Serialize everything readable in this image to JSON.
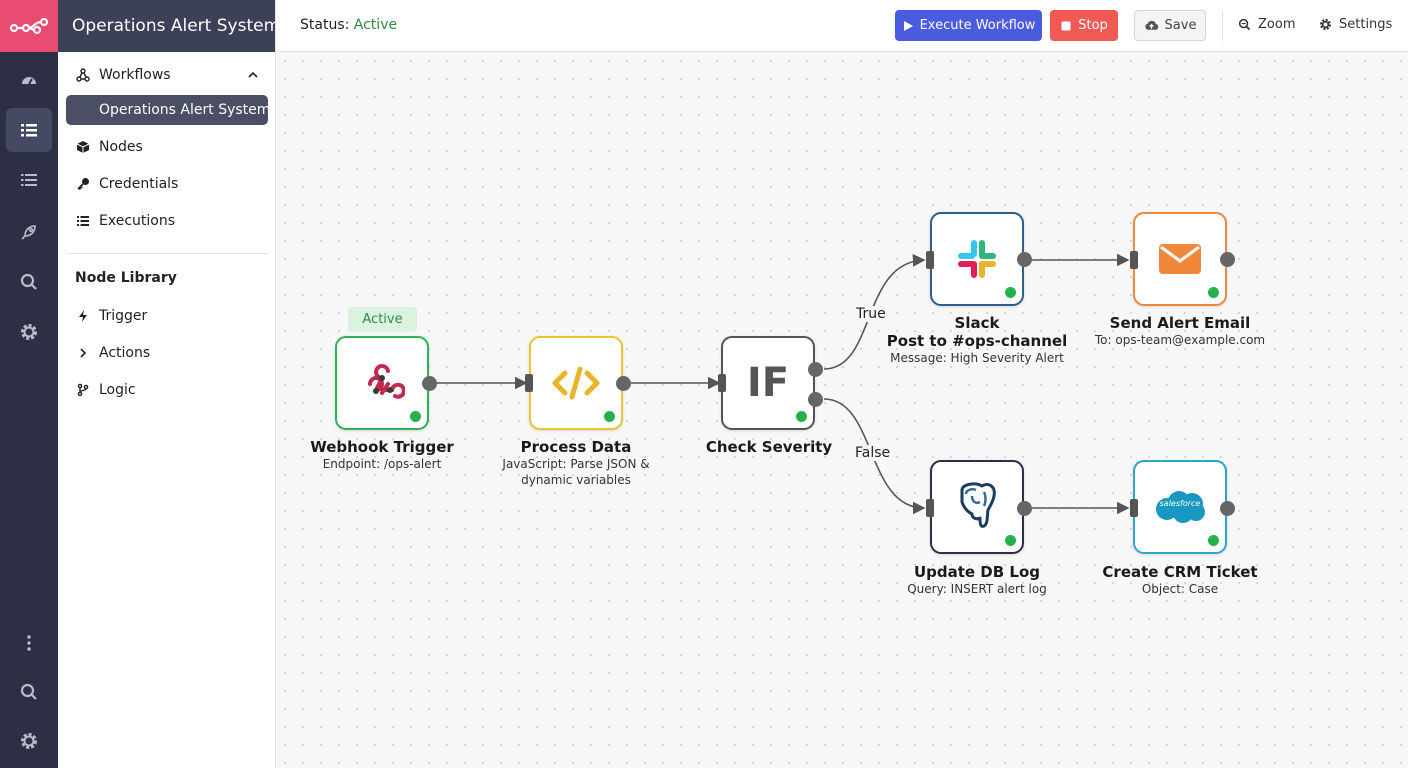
{
  "app": {
    "title": "Operations Alert System"
  },
  "rail": {
    "items": [
      {
        "icon": "n8n-logo-icon"
      },
      {
        "icon": "dashboard-icon"
      },
      {
        "icon": "list-icon"
      },
      {
        "icon": "list-alt-icon"
      },
      {
        "icon": "rocket-icon"
      },
      {
        "icon": "search-icon"
      },
      {
        "icon": "gear-icon"
      },
      {
        "icon": "more-vertical-icon"
      },
      {
        "icon": "search-icon"
      },
      {
        "icon": "gear-icon"
      }
    ]
  },
  "sidebar": {
    "workflows_label": "Workflows",
    "selected_workflow": "Operations Alert System",
    "nodes_label": "Nodes",
    "credentials_label": "Credentials",
    "executions_label": "Executions",
    "library_heading": "Node Library",
    "trigger_label": "Trigger",
    "actions_label": "Actions",
    "logic_label": "Logic"
  },
  "topbar": {
    "status_label": "Status:",
    "status_value": "Active",
    "execute_label": "Execute Workflow",
    "stop_label": "Stop",
    "save_label": "Save",
    "zoom_label": "Zoom",
    "settings_label": "Settings"
  },
  "colors": {
    "brand": "#ea4b71",
    "execute": "#4b5be0",
    "stop": "#ef5a55",
    "active": "#2e8b3e",
    "webhook": "#2fb157",
    "code": "#e6c432",
    "slack_border": "#2d5f8a",
    "email": "#f0883c",
    "salesforce": "#2aa6c9"
  },
  "canvas": {
    "active_badge": "Active",
    "edge_true": "True",
    "edge_false": "False",
    "nodes": [
      {
        "id": "webhook",
        "title": "Webhook Trigger",
        "subtitle": "Endpoint: /ops-alert",
        "subtitle2": ""
      },
      {
        "id": "code",
        "title": "Process Data",
        "subtitle": "JavaScript: Parse JSON &",
        "subtitle2": "dynamic variables"
      },
      {
        "id": "if",
        "title": "Check Severity",
        "subtitle": "",
        "subtitle2": "",
        "glyph": "IF"
      },
      {
        "id": "slack",
        "title": "Slack",
        "title2": "Post to #ops-channel",
        "subtitle": "Message: High Severity Alert"
      },
      {
        "id": "email",
        "title": "Send Alert Email",
        "subtitle": "To: ops-team@example.com"
      },
      {
        "id": "postgres",
        "title": "Update DB Log",
        "subtitle": "Query: INSERT alert log"
      },
      {
        "id": "salesforce",
        "title": "Create CRM Ticket",
        "subtitle": "Object: Case",
        "logo_text": "salesforce"
      }
    ]
  }
}
